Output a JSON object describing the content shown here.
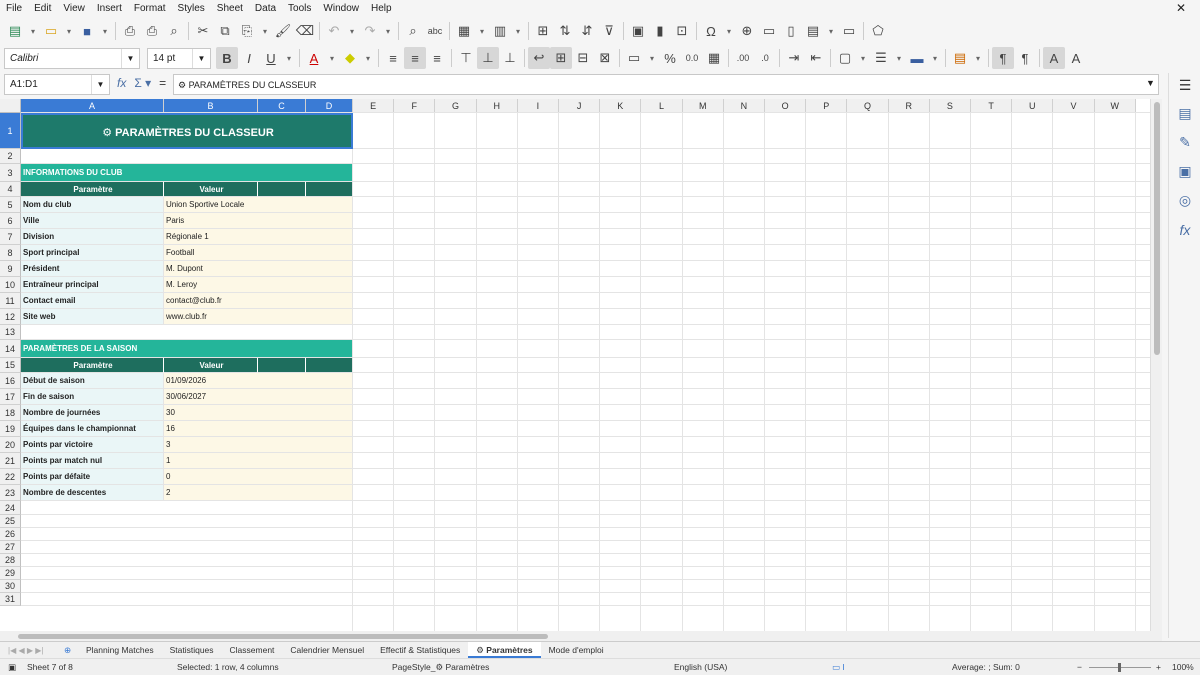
{
  "menu": [
    "File",
    "Edit",
    "View",
    "Insert",
    "Format",
    "Styles",
    "Sheet",
    "Data",
    "Tools",
    "Window",
    "Help"
  ],
  "font": {
    "name": "Calibri",
    "size": "14 pt"
  },
  "namebox": "A1:D1",
  "formula": "⚙ PARAMÈTRES DU CLASSEUR",
  "columns": [
    "A",
    "B",
    "C",
    "D",
    "E",
    "F",
    "G",
    "H",
    "I",
    "J",
    "K",
    "L",
    "M",
    "N",
    "O",
    "P",
    "Q",
    "R",
    "S",
    "T",
    "U",
    "V",
    "W"
  ],
  "rows": [
    "1",
    "2",
    "3",
    "4",
    "5",
    "6",
    "7",
    "8",
    "9",
    "10",
    "11",
    "12",
    "13",
    "14",
    "15",
    "16",
    "17",
    "18",
    "19",
    "20",
    "21",
    "22",
    "23",
    "24",
    "25",
    "26",
    "27",
    "28",
    "29",
    "30",
    "31"
  ],
  "title": "⚙ PARAMÈTRES DU CLASSEUR",
  "section1": {
    "title": "INFORMATIONS DU CLUB",
    "headers": [
      "Paramètre",
      "Valeur"
    ],
    "rows": [
      [
        "Nom du club",
        "Union Sportive Locale"
      ],
      [
        "Ville",
        "Paris"
      ],
      [
        "Division",
        "Régionale 1"
      ],
      [
        "Sport principal",
        "Football"
      ],
      [
        "Président",
        "M. Dupont"
      ],
      [
        "Entraîneur principal",
        "M. Leroy"
      ],
      [
        "Contact email",
        "contact@club.fr"
      ],
      [
        "Site web",
        "www.club.fr"
      ]
    ]
  },
  "section2": {
    "title": "PARAMÈTRES DE LA SAISON",
    "headers": [
      "Paramètre",
      "Valeur"
    ],
    "rows": [
      [
        "Début de saison",
        "01/09/2026"
      ],
      [
        "Fin de saison",
        "30/06/2027"
      ],
      [
        "Nombre de journées",
        "30"
      ],
      [
        "Équipes dans le championnat",
        "16"
      ],
      [
        "Points par victoire",
        "3"
      ],
      [
        "Points par match nul",
        "1"
      ],
      [
        "Points par défaite",
        "0"
      ],
      [
        "Nombre de descentes",
        "2"
      ]
    ]
  },
  "tabs": [
    "Planning Matches",
    "Statistiques",
    "Classement",
    "Calendrier Mensuel",
    "Effectif & Statistiques",
    "⚙ Paramètres",
    "Mode d'emploi"
  ],
  "active_tab": "⚙ Paramètres",
  "status": {
    "sheet": "Sheet 7 of 8",
    "selection": "Selected: 1 row, 4 columns",
    "pagestyle": "PageStyle_⚙ Paramètres",
    "language": "English (USA)",
    "summary": "Average: ; Sum: 0",
    "zoom": "100%"
  },
  "colors": {
    "title_bg": "#1e7a6b",
    "section_bg": "#24b59a",
    "header_bg": "#1e6e5e",
    "label_bg": "#eaf6f7",
    "value_bg": "#fdf8e6",
    "selection": "#3a7bd5"
  }
}
